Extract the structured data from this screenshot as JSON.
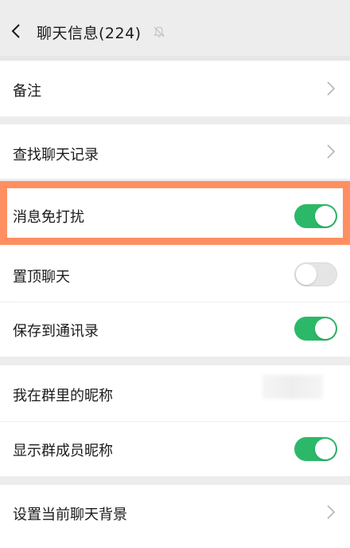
{
  "header": {
    "title": "聊天信息(224)"
  },
  "rows": {
    "remark": "备注",
    "find_history": "查找聊天记录",
    "do_not_disturb": {
      "label": "消息免打扰",
      "on": true
    },
    "pin_chat": {
      "label": "置顶聊天",
      "on": false
    },
    "save_contacts": {
      "label": "保存到通讯录",
      "on": true
    },
    "my_nickname": "我在群里的昵称",
    "show_nicknames": {
      "label": "显示群成员昵称",
      "on": true
    },
    "set_background": "设置当前聊天背景"
  },
  "colors": {
    "toggle_on": "#2cb869",
    "highlight": "#ff8f60",
    "background": "#ededed"
  }
}
